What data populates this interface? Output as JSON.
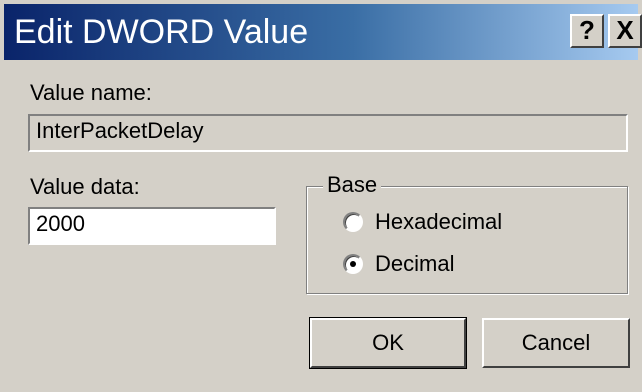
{
  "dialog": {
    "title": "Edit DWORD Value",
    "help_label": "?",
    "close_label": "X"
  },
  "value_name": {
    "label": "Value name:",
    "value": "InterPacketDelay"
  },
  "value_data": {
    "label": "Value data:",
    "value": "2000"
  },
  "base": {
    "label": "Base",
    "options": [
      {
        "label": "Hexadecimal",
        "selected": false
      },
      {
        "label": "Decimal",
        "selected": true
      }
    ]
  },
  "buttons": {
    "ok_label": "OK",
    "cancel_label": "Cancel"
  }
}
